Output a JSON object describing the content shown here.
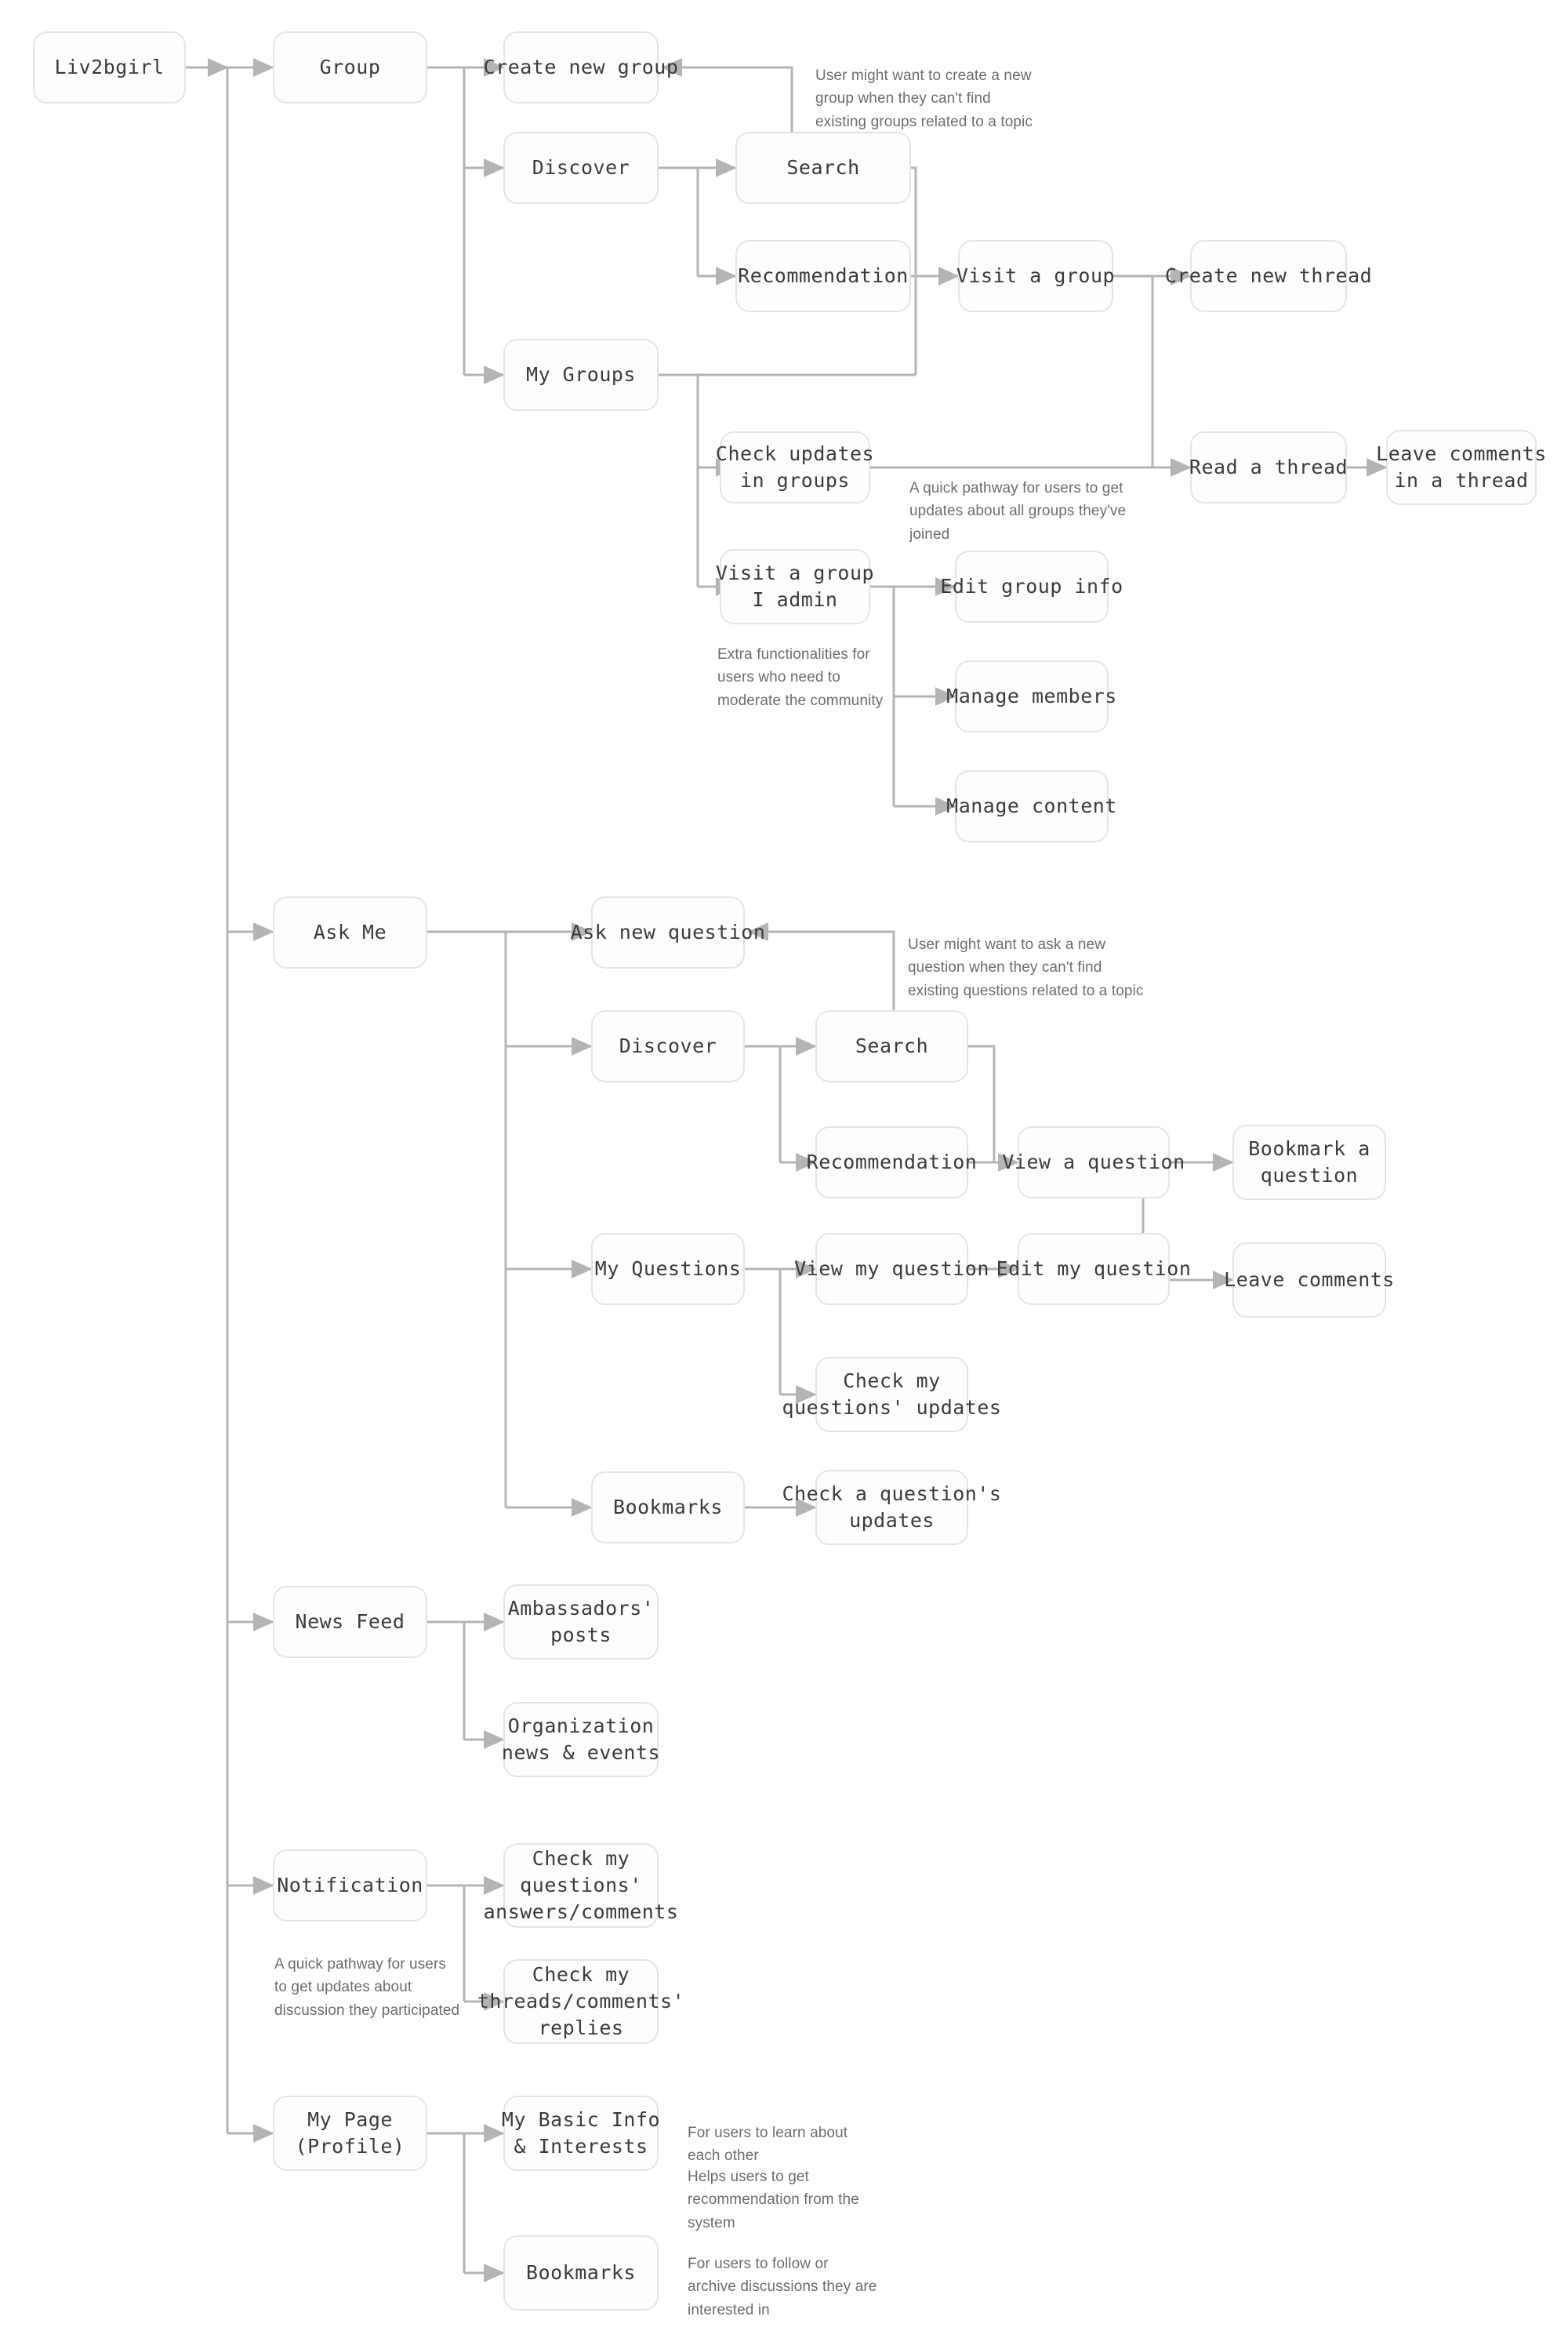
{
  "diagram": {
    "title": "Liv2bgirl",
    "type": "user-flow-sitemap",
    "colors": {
      "node_fill": "#fdfdfd",
      "node_border": "#e4e4e4",
      "node_text": "#3b3b3b",
      "edge": "#b4b4b4",
      "note_text": "#6d6d6d",
      "background": "#ffffff"
    }
  },
  "nodes": {
    "root": "Liv2bgirl",
    "group": "Group",
    "create_new_group": "Create new group",
    "group_discover": "Discover",
    "group_search": "Search",
    "group_recommendation": "Recommendation",
    "my_groups": "My Groups",
    "visit_a_group": "Visit a group",
    "create_new_thread": "Create new thread",
    "check_updates_in_groups": "Check updates\nin groups",
    "read_a_thread": "Read a thread",
    "leave_comments_in_a_thread": "Leave comments\nin a thread",
    "visit_a_group_i_admin": "Visit a group\nI admin",
    "edit_group_info": "Edit group info",
    "manage_members": "Manage members",
    "manage_content": "Manage content",
    "ask_me": "Ask Me",
    "ask_new_question": "Ask new question",
    "ask_discover": "Discover",
    "ask_search": "Search",
    "ask_recommendation": "Recommendation",
    "view_a_question": "View a question",
    "bookmark_a_question": "Bookmark a\nquestion",
    "my_questions": "My Questions",
    "view_my_question": "View my question",
    "edit_my_question": "Edit my question",
    "leave_comments": "Leave comments",
    "check_my_questions_updates": "Check my\nquestions' updates",
    "ask_bookmarks": "Bookmarks",
    "check_a_questions_updates": "Check a question's\nupdates",
    "news_feed": "News Feed",
    "ambassadors_posts": "Ambassadors'\nposts",
    "organization_news_events": "Organization\nnews & events",
    "notification": "Notification",
    "check_my_questions_answers_comments": "Check my\nquestions'\nanswers/comments",
    "check_my_threads_comments_replies": "Check my\nthreads/comments'\nreplies",
    "my_page_profile": "My Page\n(Profile)",
    "my_basic_info_interests": "My Basic Info\n& Interests",
    "profile_bookmarks": "Bookmarks"
  },
  "notes": {
    "create_group_note": "User might want to create a new\ngroup when they can't find\nexisting groups related to a topic",
    "check_updates_note": "A quick pathway for users to get\nupdates about all groups they've joined",
    "admin_note": "Extra functionalities for\nusers who need to\nmoderate the community",
    "ask_question_note": "User might want to ask a new\nquestion when they can't find\nexisting questions related to a topic",
    "notification_note": "A quick pathway for users\nto get updates about\ndiscussion they participated",
    "basic_info_note_1": "For users to learn about\neach other",
    "basic_info_note_2": "Helps users to get\nrecommendation from the\nsystem",
    "profile_bookmarks_note": "For users to follow or\narchive discussions they are\ninterested in"
  }
}
